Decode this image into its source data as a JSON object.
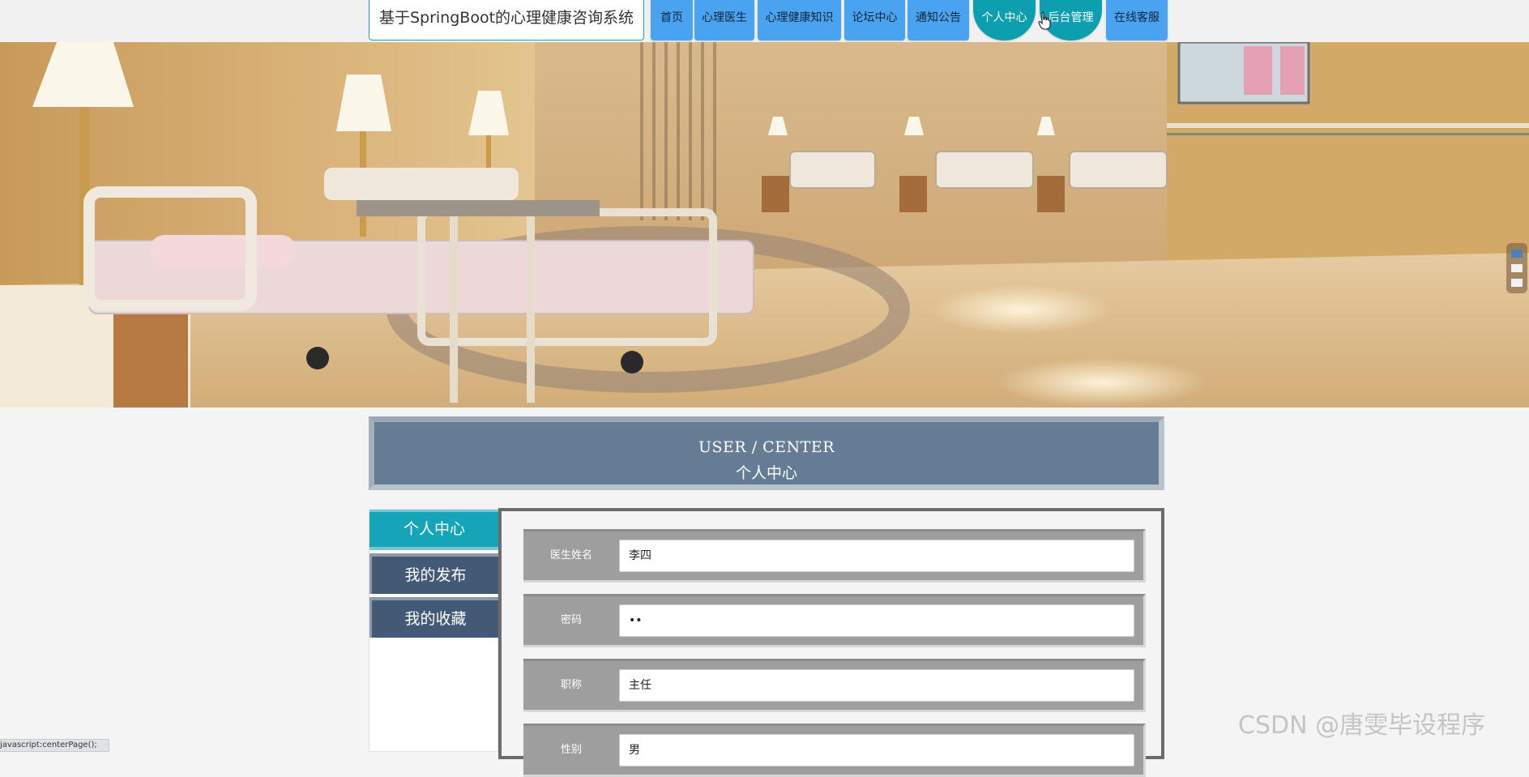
{
  "header": {
    "site_title": "基于SpringBoot的心理健康咨询系统",
    "nav": [
      {
        "label": "首页"
      },
      {
        "label": "心理医生"
      },
      {
        "label": "心理健康知识"
      },
      {
        "label": "论坛中心"
      },
      {
        "label": "通知公告"
      },
      {
        "label": "个人中心"
      },
      {
        "label": "后台管理"
      },
      {
        "label": "在线客服"
      }
    ],
    "accent_color": "#4aa3f0",
    "active_color": "#0d9fb0"
  },
  "banner": {
    "image": "hospital-ward-photo",
    "carousel_total": 3,
    "carousel_active": 1
  },
  "section": {
    "title_en": "USER / CENTER",
    "title_zh": "个人中心"
  },
  "side_menu": [
    {
      "label": "个人中心",
      "active": true
    },
    {
      "label": "我的发布",
      "active": false
    },
    {
      "label": "我的收藏",
      "active": false
    }
  ],
  "form": {
    "fields": [
      {
        "label": "医生姓名",
        "value": "李四"
      },
      {
        "label": "密码",
        "value": "••"
      },
      {
        "label": "职称",
        "value": "主任"
      },
      {
        "label": "性别",
        "value": "男"
      }
    ]
  },
  "status_bar": "javascript:centerPage();",
  "watermark": "CSDN @唐雯毕设程序"
}
